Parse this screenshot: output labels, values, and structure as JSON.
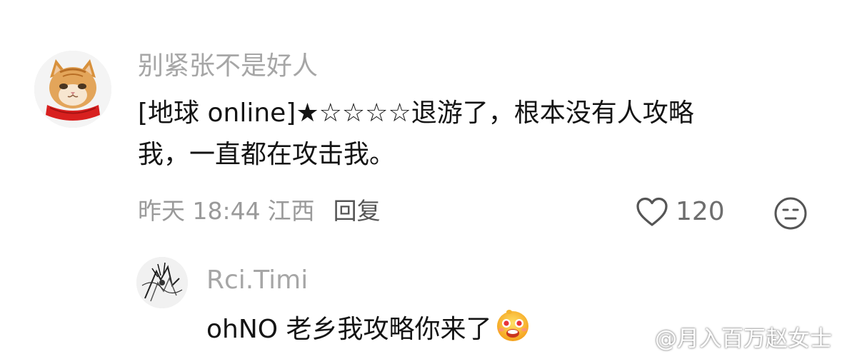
{
  "comment": {
    "username": "别紧张不是好人",
    "text_line1": "[地球 online]★☆☆☆☆退游了，根本没有人攻略",
    "text_line2": "我，一直都在攻击我。",
    "time": "昨天 18:44",
    "location": "江西",
    "reply_label": "回复",
    "like_count": "120",
    "avatar_icon": "cat-avatar-icon",
    "like_icon": "heart-outline-icon",
    "react_icon": "neutral-face-icon"
  },
  "reply": {
    "username": "Rci.Timi",
    "text": "ohNO 老乡我攻略你来了",
    "avatar_icon": "sketch-avatar-icon",
    "emoji_icon": "grinning-face-emoji"
  },
  "watermark": {
    "text": "@月入百万赵女士",
    "icon": "weibo-logo-icon"
  },
  "colors": {
    "username": "#a6a6a6",
    "text": "#141414",
    "meta": "#9a9a9a",
    "reply_button": "#555555"
  }
}
